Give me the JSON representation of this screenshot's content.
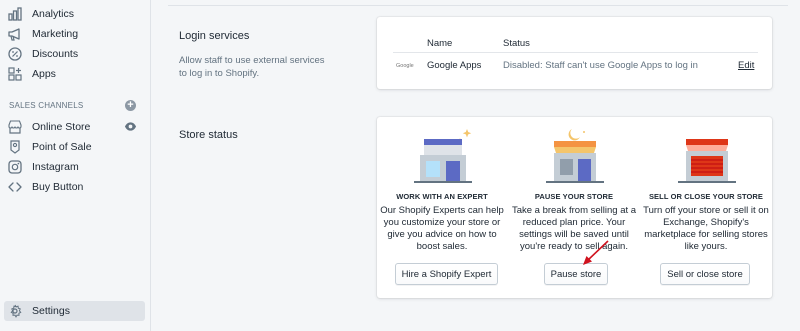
{
  "sidebar": {
    "items": [
      {
        "label": "Analytics"
      },
      {
        "label": "Marketing"
      },
      {
        "label": "Discounts"
      },
      {
        "label": "Apps"
      }
    ],
    "channels_heading": "SALES CHANNELS",
    "channels": [
      {
        "label": "Online Store"
      },
      {
        "label": "Point of Sale"
      },
      {
        "label": "Instagram"
      },
      {
        "label": "Buy Button"
      }
    ],
    "settings_label": "Settings"
  },
  "login": {
    "title": "Login services",
    "description": "Allow staff to use external services to log in to Shopify.",
    "columns": [
      "Name",
      "Status"
    ],
    "row": {
      "logo_text": "Google",
      "name": "Google Apps",
      "status": "Disabled: Staff can't use Google Apps to log in",
      "action": "Edit"
    }
  },
  "store_status": {
    "title": "Store status",
    "options": [
      {
        "heading": "WORK WITH AN EXPERT",
        "description": "Our Shopify Experts can help you customize your store or give you advice on how to boost sales.",
        "button": "Hire a Shopify Expert"
      },
      {
        "heading": "PAUSE YOUR STORE",
        "description": "Take a break from selling at a reduced plan price. Your settings will be saved until you're ready to sell again.",
        "button": "Pause store"
      },
      {
        "heading": "SELL OR CLOSE YOUR STORE",
        "description": "Turn off your store or sell it on Exchange, Shopify's marketplace for selling stores like yours.",
        "button": "Sell or close store"
      }
    ]
  },
  "colors": {
    "sidebar_bg": "#f4f6f8",
    "text": "#212b36",
    "muted": "#637381",
    "arrow": "#d0121e"
  }
}
